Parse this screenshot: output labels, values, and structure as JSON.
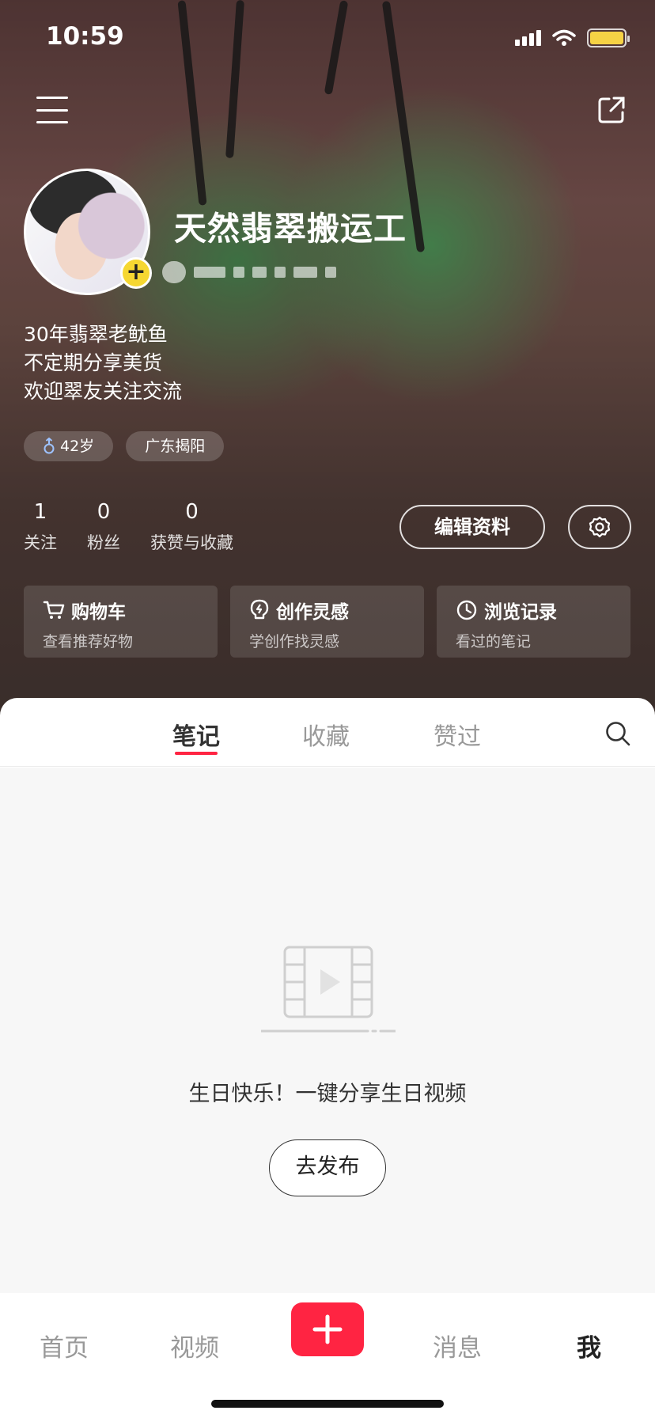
{
  "status_bar": {
    "time": "10:59"
  },
  "profile": {
    "nickname": "天然翡翠搬运工",
    "bio": [
      "30年翡翠老鱿鱼",
      "不定期分享美货",
      "欢迎翠友关注交流"
    ],
    "tags": [
      {
        "icon": "male-icon",
        "label": "42岁"
      },
      {
        "label": "广东揭阳"
      }
    ],
    "stats": [
      {
        "value": "1",
        "label": "关注"
      },
      {
        "value": "0",
        "label": "粉丝"
      },
      {
        "value": "0",
        "label": "获赞与收藏"
      }
    ],
    "edit_button": "编辑资料"
  },
  "quick_cards": [
    {
      "icon": "cart-icon",
      "title": "购物车",
      "subtitle": "查看推荐好物"
    },
    {
      "icon": "lightbulb-icon",
      "title": "创作灵感",
      "subtitle": "学创作找灵感"
    },
    {
      "icon": "clock-icon",
      "title": "浏览记录",
      "subtitle": "看过的笔记"
    }
  ],
  "tabs": [
    {
      "label": "笔记",
      "active": true
    },
    {
      "label": "收藏",
      "active": false
    },
    {
      "label": "赞过",
      "active": false
    }
  ],
  "empty_state": {
    "icon": "video-film-icon",
    "message": "生日快乐！一键分享生日视频",
    "button": "去发布"
  },
  "bottom_nav": [
    {
      "label": "首页",
      "active": false
    },
    {
      "label": "视频",
      "active": false
    },
    {
      "label": "消息",
      "active": false
    },
    {
      "label": "我",
      "active": true
    }
  ],
  "colors": {
    "accent": "#ff2442",
    "avatar_badge": "#f6d731",
    "battery": "#f6d245"
  }
}
